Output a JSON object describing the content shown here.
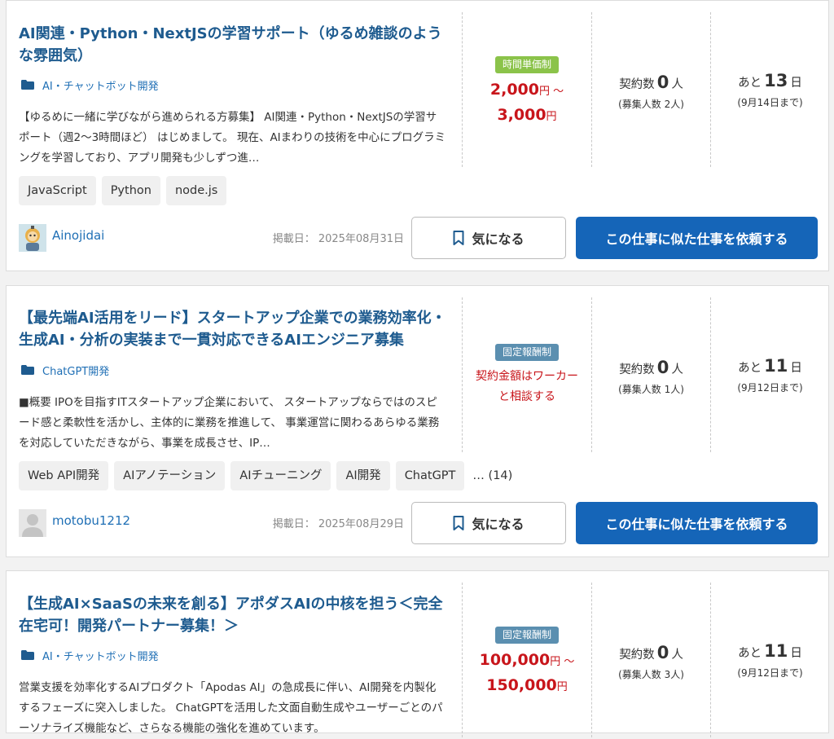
{
  "jobs": [
    {
      "title": "AI関連・Python・NextJSの学習サポート（ゆるめ雑談のような雰囲気）",
      "category": "AI・チャットボット開発",
      "description": "【ゆるめに一緒に学びながら進められる方募集】 AI関連・Python・NextJSの学習サポート（週2〜3時間ほど） はじめまして。 現在、AIまわりの技術を中心にプログラミングを学習しており、アプリ開発も少しずつ進…",
      "tags": [
        "JavaScript",
        "Python",
        "node.js"
      ],
      "tags_more": "",
      "pay_type": "時間単価制",
      "price_line1": "2,000",
      "price_line1_unit": "円 〜",
      "price_line2": "3,000",
      "price_line2_unit": "円",
      "price_text": "",
      "contract_label": "契約数",
      "contract_count": "0",
      "contract_unit": "人",
      "recruit": "(募集人数 2人)",
      "remaining_prefix": "あと",
      "remaining_days": "13",
      "remaining_unit": "日",
      "deadline": "(9月14日まで)",
      "username": "Ainojidai",
      "posted": "掲載日： 2025年08月31日",
      "favorite_label": "気になる",
      "request_label": "この仕事に似た仕事を依頼する"
    },
    {
      "title": "【最先端AI活用をリード】スタートアップ企業での業務効率化・生成AI・分析の実装まで一貫対応できるAIエンジニア募集",
      "category": "ChatGPT開発",
      "description": "■概要 IPOを目指すITスタートアップ企業において、 スタートアップならではのスピード感と柔軟性を活かし、主体的に業務を推進して、 事業運営に関わるあらゆる業務を対応していただきながら、事業を成長させ、IP…",
      "tags": [
        "Web API開発",
        "AIアノテーション",
        "AIチューニング",
        "AI開発",
        "ChatGPT"
      ],
      "tags_more": "…  (14)",
      "pay_type": "固定報酬制",
      "price_line1": "",
      "price_line1_unit": "",
      "price_line2": "",
      "price_line2_unit": "",
      "price_text": "契約金額はワーカーと相談する",
      "contract_label": "契約数",
      "contract_count": "0",
      "contract_unit": "人",
      "recruit": "(募集人数 1人)",
      "remaining_prefix": "あと",
      "remaining_days": "11",
      "remaining_unit": "日",
      "deadline": "(9月12日まで)",
      "username": "motobu1212",
      "posted": "掲載日： 2025年08月29日",
      "favorite_label": "気になる",
      "request_label": "この仕事に似た仕事を依頼する"
    },
    {
      "title": "【生成AI×SaaSの未来を創る】アポダスAIの中核を担う＜完全在宅可！開発パートナー募集！＞",
      "category": "AI・チャットボット開発",
      "description": "営業支援を効率化するAIプロダクト「Apodas AI」の急成長に伴い、AI開発を内製化するフェーズに突入しました。 ChatGPTを活用した文面自動生成やユーザーごとのパーソナライズ機能など、さらなる機能の強化を進めています。",
      "tags": [],
      "tags_more": "",
      "pay_type": "固定報酬制",
      "price_line1": "100,000",
      "price_line1_unit": "円 〜",
      "price_line2": "150,000",
      "price_line2_unit": "円",
      "price_text": "",
      "contract_label": "契約数",
      "contract_count": "0",
      "contract_unit": "人",
      "recruit": "(募集人数 3人)",
      "remaining_prefix": "あと",
      "remaining_days": "11",
      "remaining_unit": "日",
      "deadline": "(9月12日まで)",
      "username": "",
      "posted": "",
      "favorite_label": "",
      "request_label": ""
    }
  ],
  "colors": {
    "title": "#1e5b8f",
    "link": "#1f6fb5",
    "price": "#c8151b",
    "badge_hourly": "#8bc34a",
    "badge_fixed": "#5b8fb0",
    "primary_button": "#1565b8"
  },
  "icons": [
    "folder-icon",
    "bookmark-icon"
  ]
}
